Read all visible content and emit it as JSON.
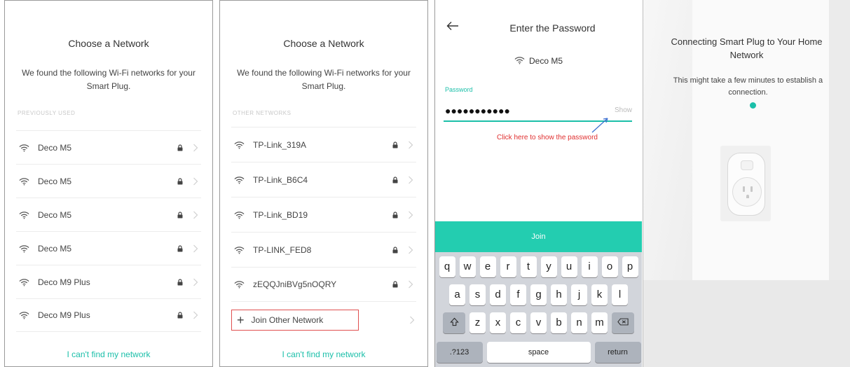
{
  "panel1": {
    "title": "Choose a Network",
    "subtitle": "We found the following Wi-Fi networks for your Smart Plug.",
    "section_label": "PREVIOUSLY USED",
    "networks": [
      {
        "name": "Deco M5"
      },
      {
        "name": "Deco M5"
      },
      {
        "name": "Deco M5"
      },
      {
        "name": "Deco M5"
      },
      {
        "name": "Deco M9 Plus"
      },
      {
        "name": "Deco M9 Plus"
      }
    ],
    "cant_find": "I can't find my network"
  },
  "panel2": {
    "title": "Choose a Network",
    "subtitle": "We found the following Wi-Fi networks for your Smart Plug.",
    "section_label": "OTHER NETWORKS",
    "networks": [
      {
        "name": "TP-Link_319A"
      },
      {
        "name": "TP-Link_B6C4"
      },
      {
        "name": "TP-Link_BD19"
      },
      {
        "name": "TP-LINK_FED8"
      },
      {
        "name": "zEQQJniBVg5nOQRY"
      }
    ],
    "join_other": "Join Other Network",
    "cant_find": "I can't find my network"
  },
  "panel3": {
    "title": "Enter the Password",
    "network": "Deco M5",
    "password_label": "Password",
    "password_value": "●●●●●●●●●●●",
    "show_label": "Show",
    "annotation": "Click here to show the password",
    "join_label": "Join",
    "keyboard": {
      "row1": [
        "q",
        "w",
        "e",
        "r",
        "t",
        "y",
        "u",
        "i",
        "o",
        "p"
      ],
      "row2": [
        "a",
        "s",
        "d",
        "f",
        "g",
        "h",
        "j",
        "k",
        "l"
      ],
      "row3": [
        "z",
        "x",
        "c",
        "v",
        "b",
        "n",
        "m"
      ],
      "num_key": ".?123",
      "space_key": "space",
      "return_key": "return"
    }
  },
  "panel4": {
    "title": "Connecting Smart Plug to Your Home Network",
    "subtitle": "This might take a few minutes to establish a connection."
  },
  "colors": {
    "accent": "#1bbfa9",
    "join_bar": "#23cdb0",
    "annotation": "#e03030"
  }
}
